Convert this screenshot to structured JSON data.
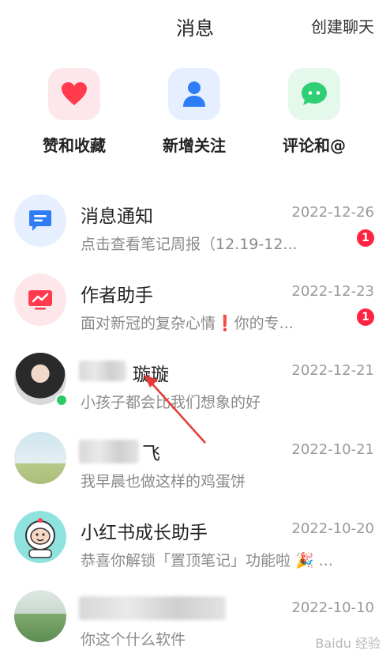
{
  "header": {
    "title": "消息",
    "create_chat": "创建聊天"
  },
  "quick_actions": [
    {
      "label": "赞和收藏",
      "icon": "heart-icon",
      "color": "#ff3b4d",
      "bg": "#fde7ea"
    },
    {
      "label": "新增关注",
      "icon": "person-icon",
      "color": "#2e7df6",
      "bg": "#e5efff"
    },
    {
      "label": "评论和@",
      "icon": "chat-bubble-icon",
      "color": "#2fcf75",
      "bg": "#e4f8ec"
    }
  ],
  "messages": [
    {
      "name": "消息通知",
      "date": "2022-12-26",
      "preview": "点击查看笔记周报（12.19-12...",
      "badge": "1"
    },
    {
      "name": "作者助手",
      "date": "2022-12-23",
      "preview": "面对新冠的复杂心情❗你的专...",
      "badge": "1"
    },
    {
      "name": "璇璇",
      "date": "2022-12-21",
      "preview": "小孩子都会比我们想象的好",
      "badge": ""
    },
    {
      "name": "飞",
      "date": "2022-10-21",
      "preview": "我早晨也做这样的鸡蛋饼",
      "badge": ""
    },
    {
      "name": "小红书成长助手",
      "date": "2022-10-20",
      "preview": "恭喜你解锁「置顶笔记」功能啦 🎉 ...",
      "badge": ""
    },
    {
      "name": "",
      "date": "2022-10-10",
      "preview": "你这个什么软件",
      "badge": ""
    }
  ],
  "watermark": "Baidu 经验"
}
